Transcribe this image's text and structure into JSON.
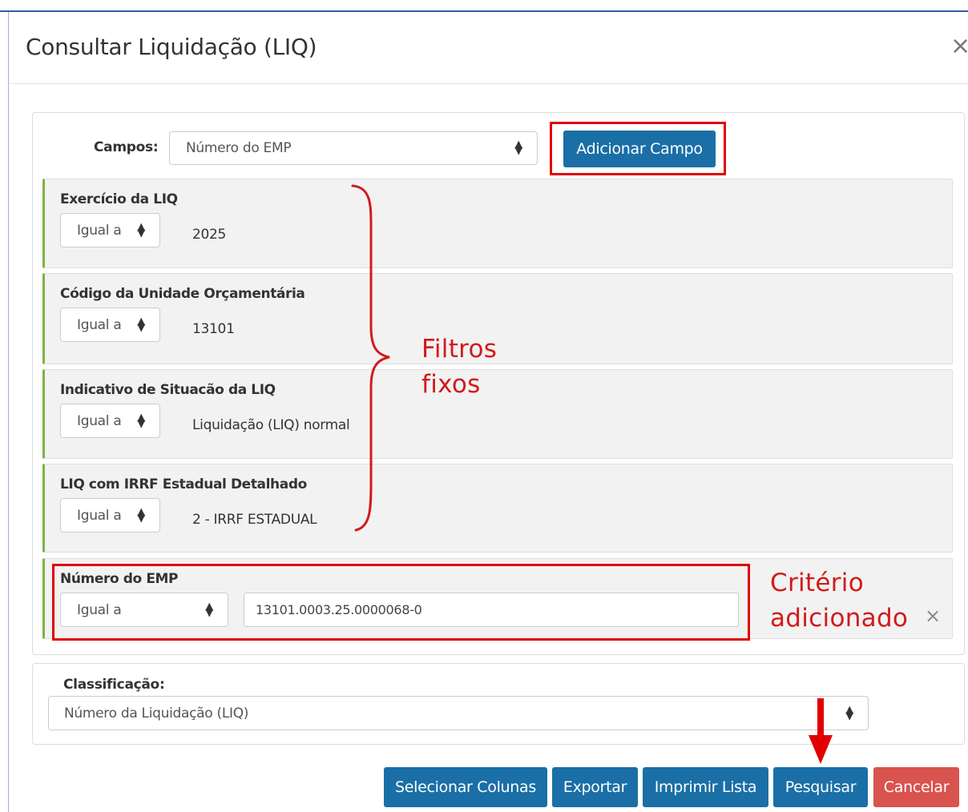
{
  "dialog": {
    "title": "Consultar Liquidação (LIQ)",
    "close_glyph": "×"
  },
  "campos": {
    "label": "Campos:",
    "selected": "Número do EMP",
    "add_button": "Adicionar Campo"
  },
  "filters": [
    {
      "label": "Exercício da LIQ",
      "operator": "Igual a",
      "value": "2025"
    },
    {
      "label": "Código da Unidade Orçamentária",
      "operator": "Igual a",
      "value": "13101"
    },
    {
      "label": "Indicativo de Situacão da LIQ",
      "operator": "Igual a",
      "value": "Liquidação (LIQ) normal"
    },
    {
      "label": "LIQ com IRRF Estadual Detalhado",
      "operator": "Igual a",
      "value": "2 - IRRF ESTADUAL"
    }
  ],
  "added_criterion": {
    "label": "Número do EMP",
    "operator": "Igual a",
    "value": "13101.0003.25.0000068-0",
    "remove_glyph": "×"
  },
  "annotations": {
    "fixed_filters_line1": "Filtros",
    "fixed_filters_line2": "fixos",
    "added_line1": "Critério",
    "added_line2": "adicionado",
    "color": "#d31a1a"
  },
  "classificacao": {
    "label": "Classificação:",
    "selected": "Número da Liquidação (LIQ)"
  },
  "footer_buttons": {
    "select_columns": "Selecionar Colunas",
    "export": "Exportar",
    "print_list": "Imprimir Lista",
    "search": "Pesquisar",
    "cancel": "Cancelar"
  },
  "colors": {
    "primary": "#1a6fa6",
    "danger": "#d9534f",
    "filter_accent": "#7cb342",
    "highlight": "#e10000"
  }
}
